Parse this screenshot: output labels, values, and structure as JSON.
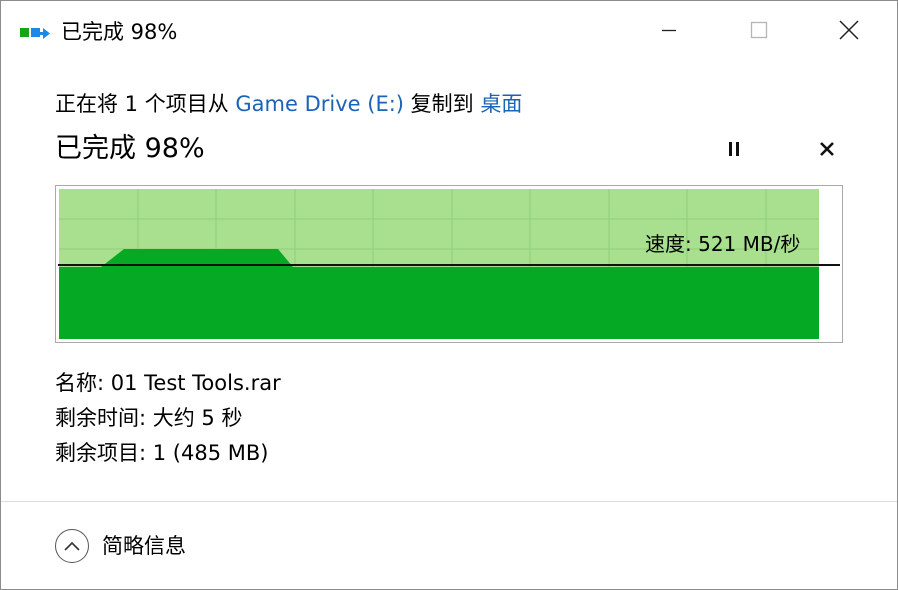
{
  "window": {
    "title": "已完成 98%",
    "icon": "copy-file-icon"
  },
  "caption_buttons": {
    "minimize_icon": "minimize-icon",
    "maximize_icon": "maximize-icon",
    "close_icon": "close-icon"
  },
  "header": {
    "prefix": "正在将 1 个项目从 ",
    "source": "Game Drive (E:)",
    "middle": " 复制到 ",
    "destination": "桌面"
  },
  "progress": {
    "title": "已完成 98%",
    "percent": 98,
    "pause_icon": "pause-icon",
    "cancel_icon": "cancel-icon"
  },
  "graph": {
    "speed_label": "速度: 521 MB/秒",
    "fill_fraction": 0.98,
    "colors": {
      "area": "#06a924",
      "background": "#a8e090",
      "grid": "#8fcf79",
      "line": "#111111",
      "border": "#a9a9a9"
    }
  },
  "details": {
    "name": "名称: 01 Test Tools.rar",
    "time_remaining": "剩余时间: 大约 5 秒",
    "items_remaining": "剩余项目: 1 (485 MB)"
  },
  "footer": {
    "toggle_label": "简略信息",
    "toggle_icon": "chevron-up-icon"
  }
}
